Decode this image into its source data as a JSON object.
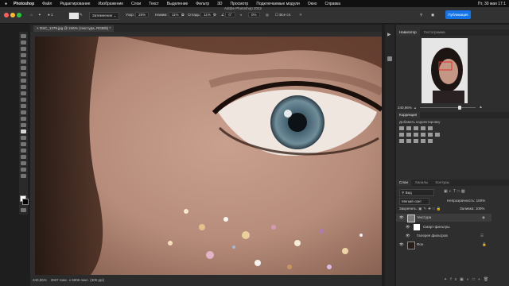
{
  "menubar": {
    "app": "Photoshop",
    "items": [
      "Файл",
      "Редактирование",
      "Изображение",
      "Слои",
      "Текст",
      "Выделение",
      "Фильтр",
      "3D",
      "Просмотр",
      "Подключаемые модули",
      "Окно",
      "Справка"
    ],
    "clock": "Пт, 30 мая  17:1"
  },
  "window": {
    "title": "Adobe Photoshop 2022"
  },
  "options": {
    "brush_size": "1",
    "mode_label": "Затемнение",
    "range_label": "Узор:",
    "range_value": "25%",
    "opacity_label": "Нажим:",
    "opacity_value": "11%",
    "flow_label": "Сгладь",
    "flow_value": "11%",
    "angle_value": "0°",
    "pct_value": "0%",
    "sample_label": "Все сл.",
    "share_label": "Публикация"
  },
  "document": {
    "tab_title": "DSC_1379.jpg @ 246% (текстура, RGB/8) *",
    "zoom_status": "240,96%",
    "size_status": "3937 пикс. x 5906 пикс. (300 ppi)"
  },
  "navigator": {
    "tabs": [
      "Навигатор",
      "Гистограмма"
    ],
    "zoom": "240,96%",
    "zoom_fraction": 0.72
  },
  "corrections": {
    "tab": "Коррекция",
    "subtitle": "Добавить корректировку"
  },
  "layers": {
    "tabs": [
      "Слои",
      "Каналы",
      "Контуры"
    ],
    "kind_label": "Вид",
    "blend_mode": "Мягкий свет",
    "opacity_label": "Непрозрачность:",
    "opacity_value": "100%",
    "lock_label": "Закрепить:",
    "fill_label": "Заливка:",
    "fill_value": "100%",
    "rows": [
      {
        "name": "текстура",
        "selected": true,
        "type": "smart"
      },
      {
        "name": "Смарт-фильтры",
        "selected": false,
        "type": "mask"
      },
      {
        "name": "Галерея фильтров",
        "selected": false,
        "type": "filter"
      },
      {
        "name": "Фон",
        "selected": false,
        "type": "photo"
      }
    ]
  },
  "colors": {
    "accent": "#1473e6",
    "panel": "#2e2e2e",
    "selected_row": "#3c3c3c"
  }
}
